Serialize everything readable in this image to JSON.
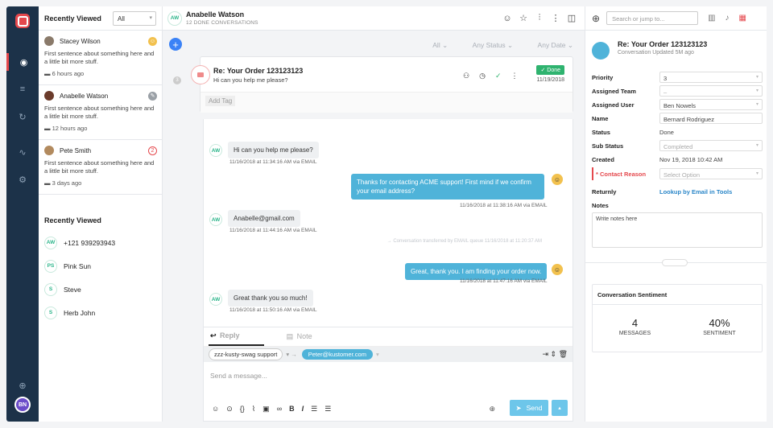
{
  "list": {
    "header": "Recently Viewed",
    "filter": "All",
    "conversations": [
      {
        "name": "Stacey Wilson",
        "preview": "First sentence about something here and a little bit more stuff.",
        "time": "6 hours ago",
        "status_color": "#f2c14e"
      },
      {
        "name": "Anabelle Watson",
        "preview": "First sentence about something here and a little bit more stuff.",
        "time": "12 hours ago",
        "status_color": "#9aa0a6"
      },
      {
        "name": "Pete Smith",
        "preview": "First sentence about something here and a little bit more stuff.",
        "time": "3 days ago",
        "status_color": "#e5484d",
        "count": "2"
      }
    ],
    "recent_title": "Recently Viewed",
    "recent": [
      {
        "initials": "AW",
        "label": "+121 939293943"
      },
      {
        "initials": "PS",
        "label": "Pink Sun"
      },
      {
        "initials": "S",
        "label": "Steve"
      },
      {
        "initials": "S",
        "label": "Herb John"
      }
    ]
  },
  "nav": {
    "avatar": "BN"
  },
  "main": {
    "initials": "AW",
    "customer_name": "Anabelle Watson",
    "done_count": "12 DONE CONVERSATIONS",
    "filters": [
      "All",
      "Any Status",
      "Any Date"
    ],
    "card": {
      "subject": "Re: Your Order 123123123",
      "preview": "Hi can you help me please?",
      "status": "✓ Done",
      "date": "11/19/2018",
      "tag_placeholder": "Add Tag",
      "index": "3"
    },
    "messages": [
      {
        "text": "Hi can you help me please?",
        "meta": "11/16/2018 at 11:34:16 AM via EMAIL"
      },
      {
        "text": "Thanks for contacting ACME support! First mind if we confirm your email address?",
        "meta": "11/16/2018 at 11:38:16 AM via EMAIL"
      },
      {
        "text": "Anabelle@gmail.com",
        "meta": "11/16/2018 at 11:44:16 AM via EMAIL"
      },
      {
        "text": "Great, thank you. I am finding your order now.",
        "meta": "11/16/2018 at 11:47:16 AM via EMAIL"
      },
      {
        "text": "Great thank you so much!",
        "meta": "11/16/2018 at 11:50:16 AM via EMAIL"
      }
    ],
    "transfer_note": "→ Conversation transferred by EMAIL queue 11/16/2018 at 11:20:37 AM",
    "reply": {
      "tab_reply": "Reply",
      "tab_note": "Note",
      "from": "zzz-kusty-swag support",
      "to": "Peter@kustomer.com",
      "placeholder": "Send a message...",
      "send": "Send"
    }
  },
  "right": {
    "search_placeholder": "Search or jump to...",
    "subject": "Re: Your Order 123123123",
    "updated": "Conversation Updated 5M ago",
    "fields": {
      "priority_label": "Priority",
      "priority": "3",
      "team_label": "Assigned Team",
      "team": "–",
      "user_label": "Assigned User",
      "user": "Ben Nowels",
      "name_label": "Name",
      "name": "Bernard Rodriguez",
      "status_label": "Status",
      "status": "Done",
      "substatus_label": "Sub Status",
      "substatus": "Completed",
      "created_label": "Created",
      "created": "Nov 19, 2018 10:42 AM",
      "reason_label": "* Contact Reason",
      "reason": "Select Option",
      "returnly_label": "Returnly",
      "returnly": "Lookup by Email in Tools",
      "notes_label": "Notes",
      "notes_placeholder": "Write notes here"
    },
    "sentiment": {
      "title": "Conversation Sentiment",
      "messages_value": "4",
      "messages_label": "MESSAGES",
      "sentiment_value": "40%",
      "sentiment_label": "SENTIMENT"
    }
  }
}
